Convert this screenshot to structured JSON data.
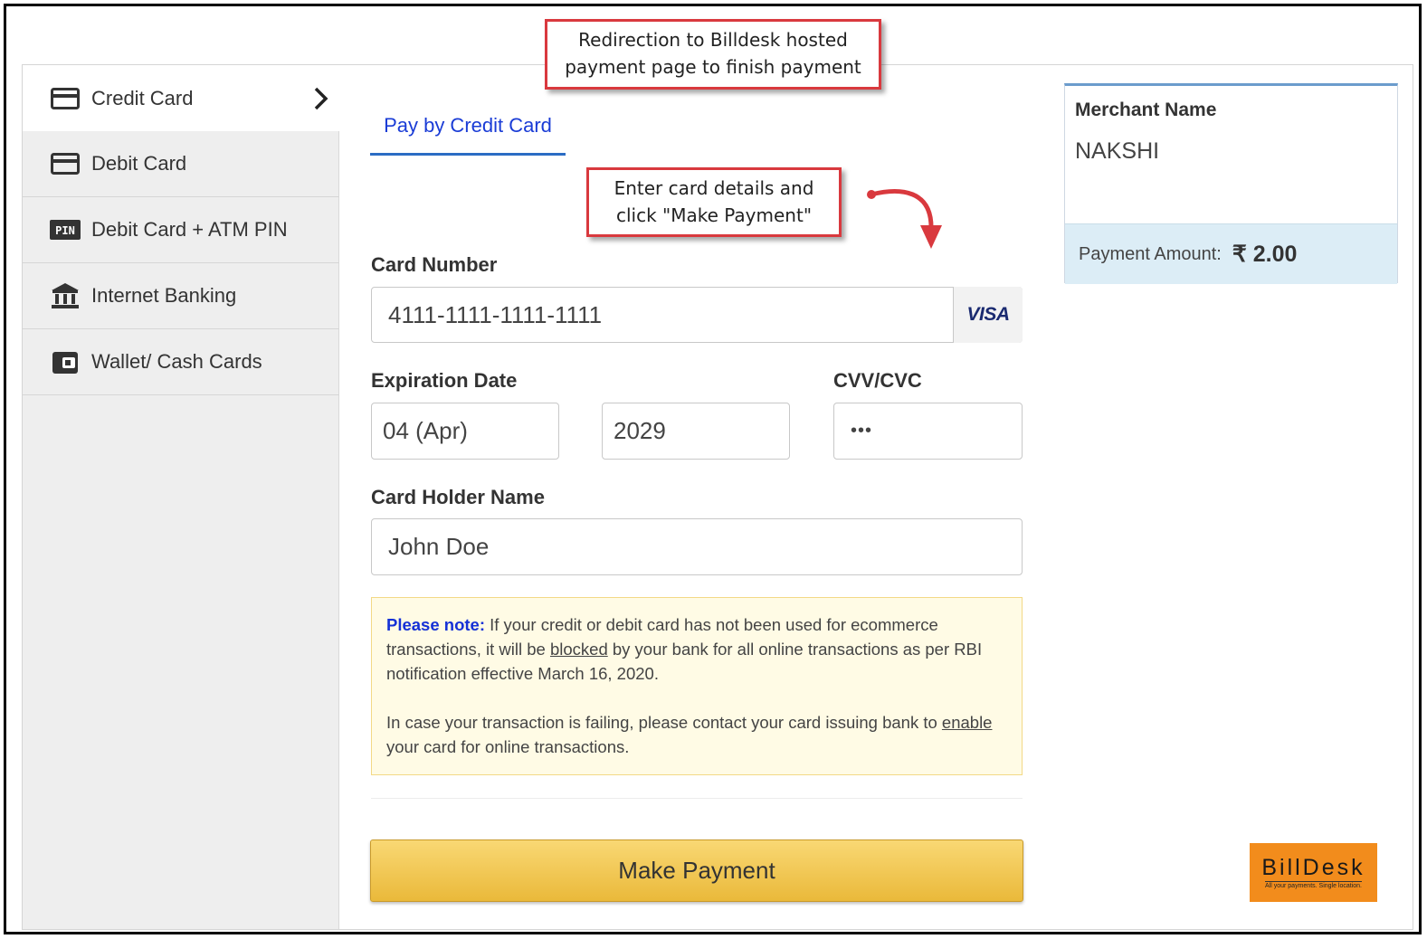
{
  "sidebar": {
    "items": [
      {
        "label": "Credit Card",
        "icon": "credit-card-icon",
        "active": true
      },
      {
        "label": "Debit Card",
        "icon": "debit-card-icon"
      },
      {
        "label": "Debit Card + ATM PIN",
        "icon": "pin-icon",
        "icon_text": "PIN"
      },
      {
        "label": "Internet Banking",
        "icon": "bank-icon"
      },
      {
        "label": "Wallet/ Cash Cards",
        "icon": "wallet-icon"
      }
    ]
  },
  "tab": {
    "label": "Pay by Credit Card"
  },
  "form": {
    "card_number_label": "Card Number",
    "card_number_value": "4111-1111-1111-1111",
    "card_brand": "VISA",
    "expiration_label": "Expiration Date",
    "exp_month": "04 (Apr)",
    "exp_year": "2029",
    "cvv_label": "CVV/CVC",
    "cvv_value": "•••",
    "holder_label": "Card Holder Name",
    "holder_value": "John Doe"
  },
  "note": {
    "heading": "Please note:",
    "p1_a": " If your credit or debit card has not been used for ecommerce transactions, it will be ",
    "p1_link": "blocked",
    "p1_b": " by your bank for all online transactions as per RBI notification effective March 16, 2020.",
    "p2_a": "In case your transaction is failing, please contact your card issuing bank to ",
    "p2_link": "enable",
    "p2_b": " your card for online transactions."
  },
  "pay_button": {
    "label": "Make Payment"
  },
  "merchant": {
    "label": "Merchant Name",
    "name": "NAKSHI",
    "amount_label": "Payment Amount:",
    "amount_value": "₹ 2.00"
  },
  "logo": {
    "name": "BillDesk",
    "tagline": "All your payments. Single location."
  },
  "annotations": {
    "top_line1": "Redirection to Billdesk hosted",
    "top_line2": "payment page to finish payment",
    "mid_line1": "Enter card details and",
    "mid_line2": "click \"Make Payment\""
  },
  "colors": {
    "accent": "#1a3cd6",
    "button": "#f0c552",
    "callout_border": "#d9393e",
    "note_bg": "#fffbe5"
  }
}
